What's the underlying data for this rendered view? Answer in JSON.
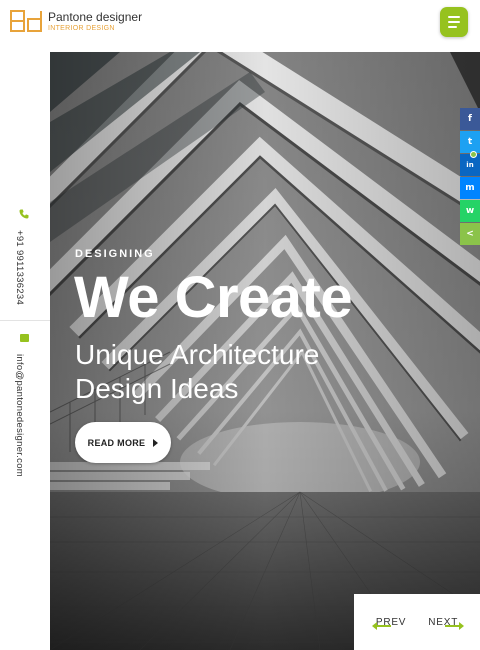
{
  "brand": {
    "mark": "Pd",
    "name": "Pantone designer",
    "tagline": "INTERIOR DESIGN",
    "accent_color": "#96c21f",
    "logo_color": "#e8a33a"
  },
  "header": {
    "menu_icon": "hamburger-menu-icon"
  },
  "contact": {
    "phone_icon": "phone-icon",
    "phone": "+91 9911336234",
    "email_icon": "mail-icon",
    "email": "info@pantonedesigner.com"
  },
  "hero": {
    "eyebrow": "DESIGNING",
    "headline": "We Create",
    "subline_1": "Unique Architecture",
    "subline_2": "Design Ideas",
    "cta_label": "READ MORE"
  },
  "slider_nav": {
    "prev_label": "PREV",
    "next_label": "NEXT"
  },
  "social": [
    {
      "name": "facebook",
      "glyph": "f",
      "color": "#3b5998"
    },
    {
      "name": "twitter",
      "glyph": "t",
      "color": "#1da1f2"
    },
    {
      "name": "linkedin",
      "glyph": "in",
      "color": "#0a66c2"
    },
    {
      "name": "messenger",
      "glyph": "m",
      "color": "#0084ff"
    },
    {
      "name": "whatsapp",
      "glyph": "w",
      "color": "#25d366"
    },
    {
      "name": "share",
      "glyph": "<",
      "color": "#8bc34a"
    }
  ]
}
